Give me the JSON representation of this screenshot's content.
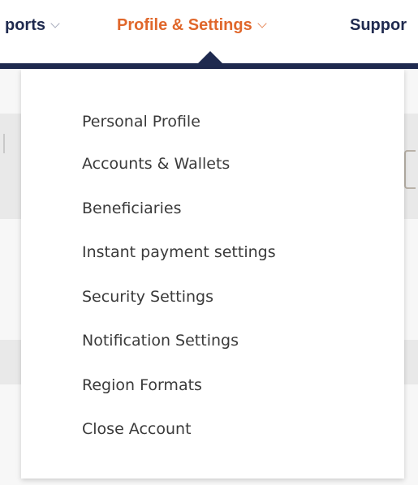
{
  "nav": {
    "items": [
      {
        "label": "ports",
        "active": false
      },
      {
        "label": "Profile & Settings",
        "active": true
      },
      {
        "label": "Suppor",
        "active": false
      }
    ]
  },
  "dropdown": {
    "items": [
      {
        "label": "Personal Profile"
      },
      {
        "label": "Accounts & Wallets"
      },
      {
        "label": "Beneficiaries"
      },
      {
        "label": "Instant payment settings"
      },
      {
        "label": "Security Settings"
      },
      {
        "label": "Notification Settings"
      },
      {
        "label": "Region Formats"
      },
      {
        "label": "Close Account"
      }
    ]
  },
  "colors": {
    "nav_text": "#1f2a4f",
    "active_text": "#e0672b",
    "nav_bar": "#1f2a4f",
    "menu_text": "#3a3a3a"
  },
  "icons": {
    "nav_chevron": "chevron-down-icon",
    "active_indicator": "caret-up-icon"
  }
}
